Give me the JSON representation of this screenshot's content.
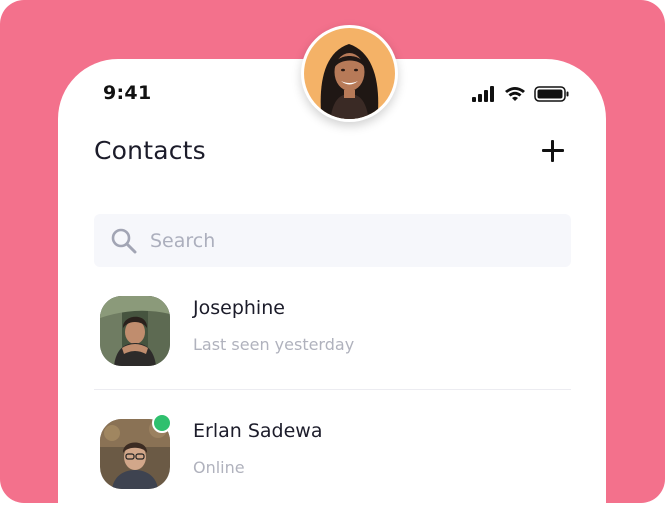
{
  "colors": {
    "background": "#f3718c",
    "card": "#ffffff",
    "search_bg": "#f6f7fb",
    "text_primary": "#1c1c2a",
    "text_secondary": "#b0b2bd",
    "online": "#2fc06e"
  },
  "status_bar": {
    "time": "9:41",
    "icons": [
      "signal-icon",
      "wifi-icon",
      "battery-icon"
    ]
  },
  "header": {
    "title": "Contacts",
    "add_icon": "plus-icon"
  },
  "search": {
    "placeholder": "Search",
    "value": "",
    "icon": "search-icon"
  },
  "contacts": [
    {
      "name": "Josephine",
      "status": "Last seen yesterday",
      "online": false
    },
    {
      "name": "Erlan Sadewa",
      "status": "Online",
      "online": true
    }
  ]
}
